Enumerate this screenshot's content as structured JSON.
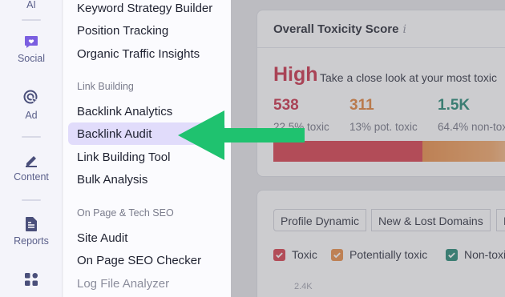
{
  "rail": {
    "items": [
      {
        "label": "AI",
        "icon": "ai-icon"
      },
      {
        "label": "Social",
        "icon": "social-chat-icon"
      },
      {
        "label": "Ad",
        "icon": "ad-cursor-icon"
      },
      {
        "label": "Content",
        "icon": "content-pen-icon"
      },
      {
        "label": "Reports",
        "icon": "reports-document-icon"
      },
      {
        "label": "",
        "icon": "apps-grid-icon"
      }
    ]
  },
  "menu": {
    "top_items": [
      "Keyword Strategy Builder",
      "Position Tracking",
      "Organic Traffic Insights"
    ],
    "link_building_heading": "Link Building",
    "link_building_items": [
      "Backlink Analytics",
      "Backlink Audit",
      "Link Building Tool",
      "Bulk Analysis"
    ],
    "active_item": "Backlink Audit",
    "onpage_heading": "On Page & Tech SEO",
    "onpage_items": [
      "Site Audit",
      "On Page SEO Checker",
      "Log File Analyzer"
    ]
  },
  "toxicity_card": {
    "title": "Overall Toxicity Score",
    "info_icon": "i",
    "level": "High",
    "description": "Take a close look at your most toxic",
    "stats": [
      {
        "value": "538",
        "label": "22.5% toxic",
        "color": "#c7233d"
      },
      {
        "value": "311",
        "label": "13% pot. toxic",
        "color": "#e07b2e"
      },
      {
        "value": "1.5K",
        "label": "64.4% non-toxic",
        "color": "#15806b"
      }
    ],
    "bar": {
      "toxic_pct": 22.5,
      "potentially_toxic_pct": 13,
      "non_toxic_pct": 64.4
    }
  },
  "chart_card": {
    "tabs": [
      "Profile Dynamic",
      "New & Lost Domains",
      "D"
    ],
    "legend": [
      {
        "label": "Toxic",
        "color": "#d6313f"
      },
      {
        "label": "Potentially toxic",
        "color": "#e8863a"
      },
      {
        "label": "Non-toxic",
        "color": "#15806b"
      }
    ],
    "y_tick": "2.4K"
  },
  "colors": {
    "accent_active_bg": "#e1dcfb",
    "arrow": "#1fc26f"
  }
}
